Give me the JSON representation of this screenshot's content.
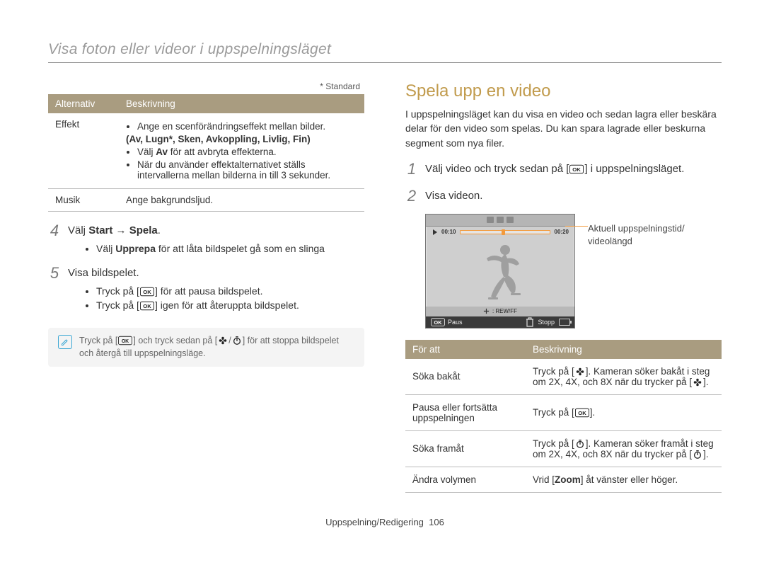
{
  "header": "Visa foton eller videor i uppspelningsläget",
  "standard_note": "* Standard",
  "options_table": {
    "headers": [
      "Alternativ",
      "Beskrivning"
    ],
    "rows": [
      {
        "label": "Effekt",
        "bullets": [
          "Ange en scenförändringseffekt mellan bilder.",
          "(Av, Lugn*, Sken, Avkoppling, Livlig, Fin)",
          "Välj Av för att avbryta effekterna.",
          "När du använder effektalternativet ställs intervallerna mellan bilderna in till 3 sekunder."
        ],
        "bold_line2": "(Av, Lugn*, Sken, Avkoppling, Livlig, Fin)",
        "bold_prefix3": "Av"
      },
      {
        "label": "Musik",
        "text": "Ange bakgrundsljud."
      }
    ]
  },
  "left_steps": {
    "step4": {
      "num": "4",
      "prefix": "Välj ",
      "bold": "Start → Spela",
      "suffix": ".",
      "sub": [
        "Välj Upprepa för att låta bildspelet gå som en slinga"
      ],
      "sub_bold1": "Upprepa"
    },
    "step5": {
      "num": "5",
      "text": "Visa bildspelet.",
      "sub": [
        "Tryck på [OK] för att pausa bildspelet.",
        "Tryck på [OK] igen för att återuppta bildspelet."
      ]
    }
  },
  "tip": {
    "prefix": "Tryck på [",
    "mid1": "] och tryck sedan på [",
    "slash": "/",
    "mid2": "] för att stoppa bildspelet och återgå till uppspelningsläge."
  },
  "right": {
    "title": "Spela upp en video",
    "intro": "I uppspelningsläget kan du visa en video och sedan lagra eller beskära delar för den video som spelas. Du kan spara lagrade eller beskurna segment som nya filer.",
    "step1": {
      "num": "1",
      "prefix": "Välj video och tryck sedan på [",
      "suffix": "] i uppspelningsläget."
    },
    "step2": {
      "num": "2",
      "text": "Visa videon."
    },
    "video": {
      "t_cur": "00:10",
      "t_tot": "00:20",
      "rewff": ": REW/FF",
      "pause": "Paus",
      "stop": "Stopp",
      "caption": "Aktuell uppspelningstid/\nvideolängd"
    },
    "play_table": {
      "headers": [
        "För att",
        "Beskrivning"
      ],
      "rows": [
        {
          "label": "Söka bakåt",
          "desc_prefix": "Tryck på [",
          "desc_mid": "]. Kameran söker bakåt i steg om 2X, 4X, och 8X när du trycker på [",
          "desc_suffix": "]."
        },
        {
          "label": "Pausa eller fortsätta uppspelningen",
          "desc_prefix": "Tryck på [",
          "desc_suffix": "]."
        },
        {
          "label": "Söka framåt",
          "desc_prefix": "Tryck på [",
          "desc_mid": "]. Kameran söker framåt i steg om 2X, 4X, och 8X när du trycker på [",
          "desc_suffix": "]."
        },
        {
          "label": "Ändra volymen",
          "desc_prefix": "Vrid [",
          "desc_bold": "Zoom",
          "desc_suffix": "] åt vänster eller höger."
        }
      ]
    }
  },
  "footer": {
    "section": "Uppspelning/Redigering",
    "page": "106"
  }
}
